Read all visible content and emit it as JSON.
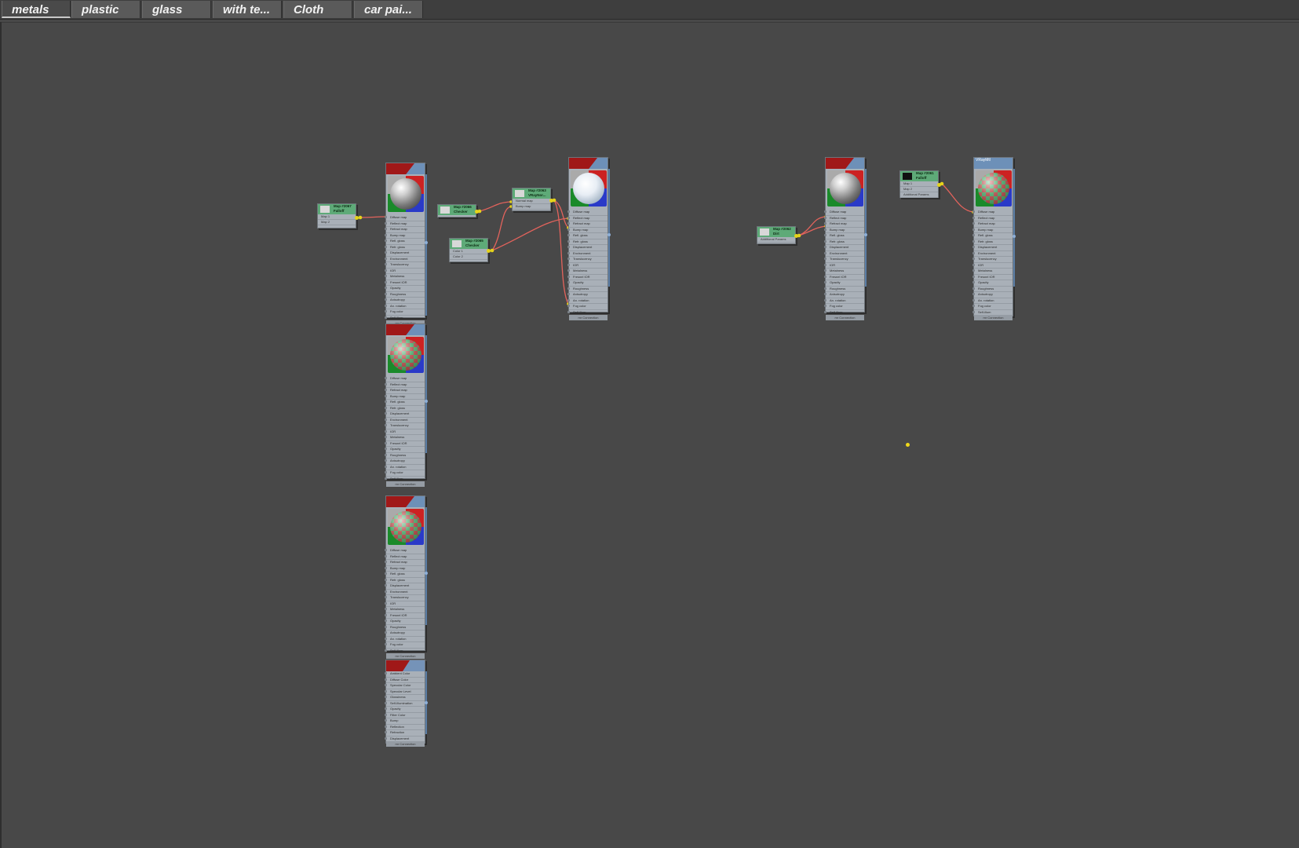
{
  "tabs": [
    {
      "label": "metals",
      "active": true
    },
    {
      "label": "plastic",
      "active": false
    },
    {
      "label": "glass",
      "active": false
    },
    {
      "label": "with te...",
      "active": false
    },
    {
      "label": "Cloth",
      "active": false
    },
    {
      "label": "car pai...",
      "active": false
    }
  ],
  "material_slots": [
    "Diffuse map",
    "Reflect map",
    "Refract map",
    "Bump map",
    "Refl. gloss",
    "Refr. gloss",
    "Displacement",
    "Environment",
    "Translucency",
    "IOR",
    "Metalness",
    "Fresnel IOR",
    "Opacity",
    "Roughness",
    "Anisotropy",
    "An. rotation",
    "Fog color",
    "Self-illum"
  ],
  "standard_slots": [
    "Ambient Color",
    "Diffuse Color",
    "Specular Color",
    "Specular Level",
    "Glossiness",
    "Self-Illumination",
    "Opacity",
    "Filter Color",
    "Bump",
    "Reflection",
    "Refraction",
    "Displacement"
  ],
  "footer_label": "mr Connection",
  "nodes": {
    "falloff_map_1": {
      "title": "Map #2067 Falloff",
      "rows": [
        "Map 1",
        "Map 2"
      ]
    },
    "checker_map_1": {
      "title": "Map #2066 Checker",
      "rows": []
    },
    "checker_map_2": {
      "title": "Map #2065 Checker",
      "rows": [
        "Color 1",
        "Color 2"
      ]
    },
    "normal_map": {
      "title": "Map #2063 VRayNor...",
      "rows": [
        "Normal map",
        "Bump map"
      ]
    },
    "dirt_map": {
      "title": "Map #2062 Dirt",
      "rows": [
        "Additional Params"
      ]
    },
    "falloff_map_2": {
      "title": "Map #2061 Falloff",
      "rows": [
        "Map 1",
        "Map 2",
        "Additional Params"
      ]
    },
    "vraymtl_title": "VRayMtl"
  },
  "colors": {
    "accent": "#6d90b8",
    "map_header": "#5eaa78",
    "wire": "#e3635c",
    "pin": "#e5d31b"
  }
}
